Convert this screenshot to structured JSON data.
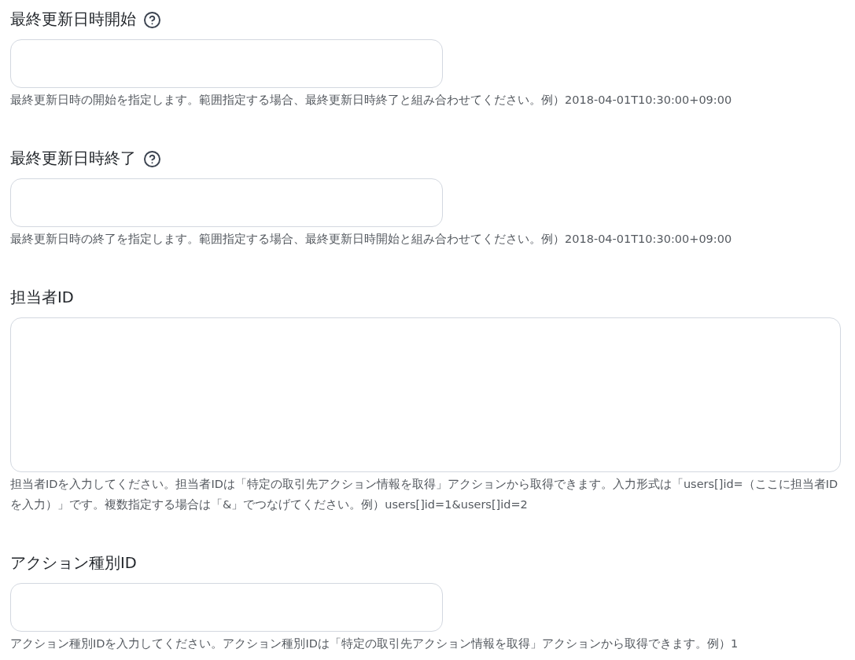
{
  "fields": [
    {
      "label": "最終更新日時開始",
      "help_icon": true,
      "kind": "input",
      "help_text": "最終更新日時の開始を指定します。範囲指定する場合、最終更新日時終了と組み合わせてください。例）2018-04-01T10:30:00+09:00"
    },
    {
      "label": "最終更新日時終了",
      "help_icon": true,
      "kind": "input",
      "help_text": "最終更新日時の終了を指定します。範囲指定する場合、最終更新日時開始と組み合わせてください。例）2018-04-01T10:30:00+09:00"
    },
    {
      "label": "担当者ID",
      "help_icon": false,
      "kind": "textarea",
      "help_text": "担当者IDを入力してください。担当者IDは「特定の取引先アクション情報を取得」アクションから取得できます。入力形式は「users[]id=（ここに担当者IDを入力）」です。複数指定する場合は「&」でつなげてください。例）users[]id=1&users[]id=2"
    },
    {
      "label": "アクション種別ID",
      "help_icon": false,
      "kind": "input",
      "help_text": "アクション種別IDを入力してください。アクション種別IDは「特定の取引先アクション情報を取得」アクションから取得できます。例）1"
    }
  ]
}
